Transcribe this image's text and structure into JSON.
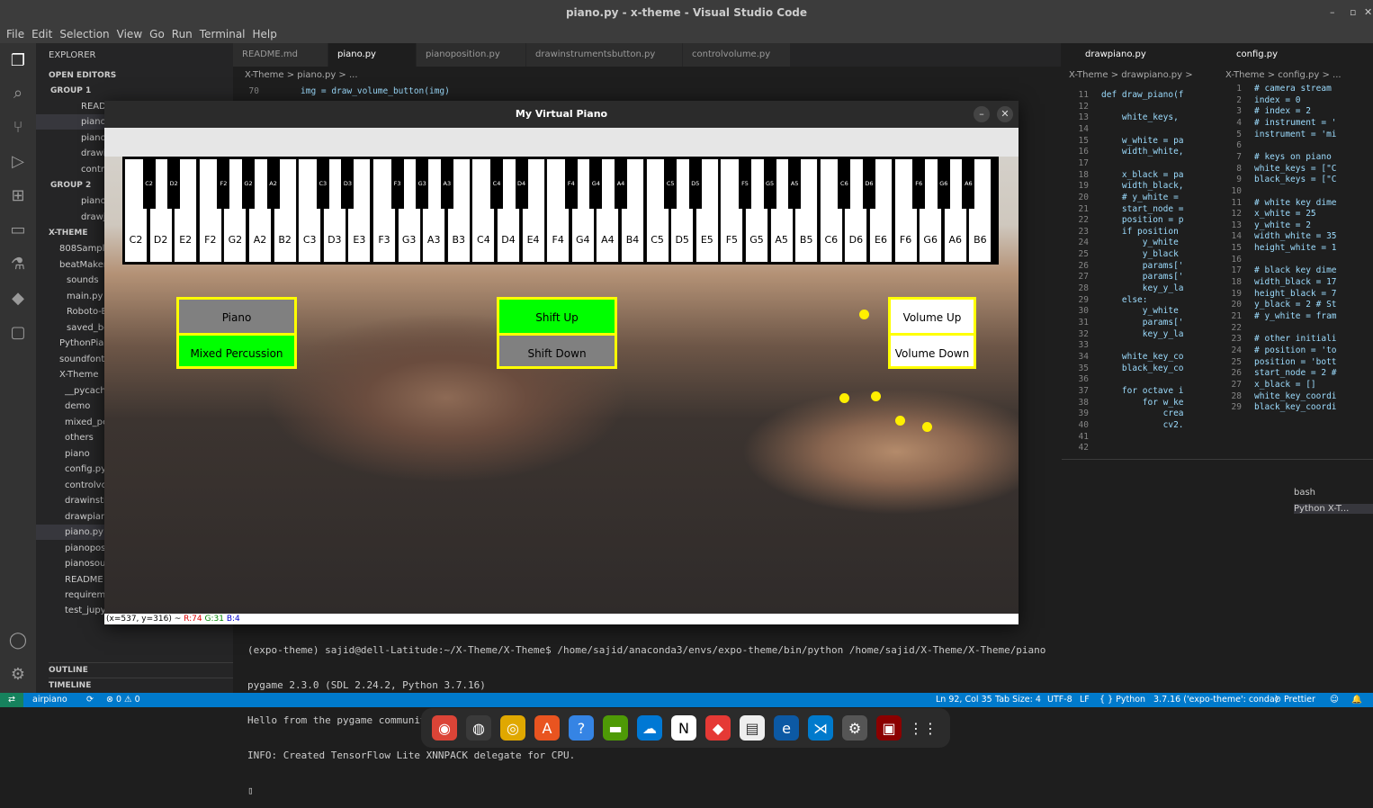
{
  "window": {
    "title": "piano.py - x-theme - Visual Studio Code"
  },
  "menu": [
    "File",
    "Edit",
    "Selection",
    "View",
    "Go",
    "Run",
    "Terminal",
    "Help"
  ],
  "explorer": {
    "title": "EXPLORER",
    "open_editors": "OPEN EDITORS",
    "group1": "GROUP 1",
    "group1_items": [
      "READ",
      "piano",
      "piano",
      "drawi",
      "contr"
    ],
    "group2": "GROUP 2",
    "group2_items": [
      "piano",
      "drawj"
    ],
    "xtheme": "X-THEME",
    "tree": [
      "808Sample",
      "beatMaker",
      "sounds",
      "main.py",
      "Roboto-B",
      "saved_be",
      "PythonPia",
      "soundfont",
      "X-Theme",
      "__pycach",
      "demo",
      "mixed_pe",
      "others",
      "piano",
      "config.py",
      "controlvo",
      "drawinstr",
      "drawpian",
      "piano.py",
      "pianopos",
      "pianosou",
      "README",
      "requirem",
      "test_jupy"
    ],
    "outline": "OUTLINE",
    "timeline": "TIMELINE"
  },
  "tabs": [
    "README.md",
    "piano.py",
    "pianoposition.py",
    "drawinstrumentsbutton.py",
    "controlvolume.py"
  ],
  "breadcrumb": "X-Theme > piano.py > ...",
  "editor": {
    "line_no": "70",
    "line": "img = draw_volume_button(img)"
  },
  "pane1": {
    "tab": "drawpiano.py",
    "breadcrumb": "X-Theme > drawpiano.py >",
    "lines": [
      [
        "11",
        "def draw_piano(f"
      ],
      [
        "12",
        ""
      ],
      [
        "13",
        "    white_keys, "
      ],
      [
        "14",
        ""
      ],
      [
        "15",
        "    w_white = pa"
      ],
      [
        "16",
        "    width_white,"
      ],
      [
        "17",
        ""
      ],
      [
        "18",
        "    x_black = pa"
      ],
      [
        "19",
        "    width_black,"
      ],
      [
        "20",
        "    # y_white ="
      ],
      [
        "21",
        "    start_node ="
      ],
      [
        "22",
        "    position = p"
      ],
      [
        "23",
        "    if position "
      ],
      [
        "24",
        "        y_white "
      ],
      [
        "25",
        "        y_black "
      ],
      [
        "26",
        "        params['"
      ],
      [
        "27",
        "        params['"
      ],
      [
        "28",
        "        key_y_la"
      ],
      [
        "29",
        "    else:"
      ],
      [
        "30",
        "        y_white "
      ],
      [
        "31",
        "        params['"
      ],
      [
        "32",
        "        key_y_la"
      ],
      [
        "33",
        ""
      ],
      [
        "34",
        "    white_key_co"
      ],
      [
        "35",
        "    black_key_co"
      ],
      [
        "36",
        ""
      ],
      [
        "37",
        "    for octave i"
      ],
      [
        "38",
        "        for w_ke"
      ],
      [
        "39",
        "            crea"
      ],
      [
        "40",
        "            cv2."
      ],
      [
        "41",
        ""
      ],
      [
        "42",
        ""
      ]
    ]
  },
  "pane2": {
    "tab": "config.py",
    "breadcrumb": "X-Theme > config.py > ...",
    "lines": [
      [
        "1",
        "# camera stream"
      ],
      [
        "2",
        "index = 0"
      ],
      [
        "3",
        "# index = 2"
      ],
      [
        "4",
        "# instrument = '"
      ],
      [
        "5",
        "instrument = 'mi"
      ],
      [
        "6",
        ""
      ],
      [
        "7",
        "# keys on piano"
      ],
      [
        "8",
        "white_keys = [\"C"
      ],
      [
        "9",
        "black_keys = [\"C"
      ],
      [
        "10",
        ""
      ],
      [
        "11",
        "# white key dime"
      ],
      [
        "12",
        "x_white = 25"
      ],
      [
        "13",
        "y_white = 2"
      ],
      [
        "14",
        "width_white = 35"
      ],
      [
        "15",
        "height_white = 1"
      ],
      [
        "16",
        ""
      ],
      [
        "17",
        "# black key dime"
      ],
      [
        "18",
        "width_black = 17"
      ],
      [
        "19",
        "height_black = 7"
      ],
      [
        "20",
        "y_black = 2 # St"
      ],
      [
        "21",
        "# y_white = fram"
      ],
      [
        "22",
        ""
      ],
      [
        "23",
        "# other initiali"
      ],
      [
        "24",
        "# position = 'to"
      ],
      [
        "25",
        "position = 'bott"
      ],
      [
        "26",
        "start_node = 2 #"
      ],
      [
        "27",
        "x_black = []"
      ],
      [
        "28",
        "white_key_coordi"
      ],
      [
        "29",
        "black_key_coordi"
      ]
    ]
  },
  "terminal": {
    "lines": [
      "(expo-theme) sajid@dell-Latitude:~/X-Theme/X-Theme$ /home/sajid/anaconda3/envs/expo-theme/bin/python /home/sajid/X-Theme/X-Theme/piano.py",
      "pygame 2.3.0 (SDL 2.24.2, Python 3.7.16)",
      "Hello from the pygame community. https://www.pygame.org/contribute.html",
      "INFO: Created TensorFlow Lite XNNPACK delegate for CPU."
    ],
    "sessions": [
      "bash",
      "Python X-T..."
    ]
  },
  "status": {
    "branch": "airpiano",
    "problems": "⊗ 0 ⚠ 0",
    "position": "Ln 92, Col 35",
    "tab": "Tab Size: 4",
    "encoding": "UTF-8",
    "eol": "LF",
    "lang": "{ } Python",
    "interp": "3.7.16 ('expo-theme': conda)",
    "prettier": "⊘ Prettier"
  },
  "piano_window": {
    "title": "My Virtual Piano",
    "white_keys": [
      "C2",
      "D2",
      "E2",
      "F2",
      "G2",
      "A2",
      "B2",
      "C3",
      "D3",
      "E3",
      "F3",
      "G3",
      "A3",
      "B3",
      "C4",
      "D4",
      "E4",
      "F4",
      "G4",
      "A4",
      "B4",
      "C5",
      "D5",
      "E5",
      "F5",
      "G5",
      "A5",
      "B5",
      "C6",
      "D6",
      "E6",
      "F6",
      "G6",
      "A6",
      "B6"
    ],
    "black_keys": [
      "C2",
      "D2",
      "F2",
      "G2",
      "A2",
      "C3",
      "D3",
      "F3",
      "G3",
      "A3",
      "C4",
      "D4",
      "F4",
      "G4",
      "A4",
      "C5",
      "D5",
      "F5",
      "G5",
      "A5",
      "C6",
      "D6",
      "F6",
      "G6",
      "A6"
    ],
    "buttons": {
      "piano": "Piano",
      "mixed": "Mixed Percussion",
      "shift_up": "Shift Up",
      "shift_down": "Shift Down",
      "vol_up": "Volume Up",
      "vol_down": "Volume Down"
    },
    "status_coords": "(x=537, y=316) ~",
    "status_r": "R:74",
    "status_g": "G:31",
    "status_b": "B:4"
  },
  "colors": {
    "green": "#00ff00",
    "grey": "#808080",
    "yellow": "#ffff00",
    "accent": "#007acc"
  }
}
